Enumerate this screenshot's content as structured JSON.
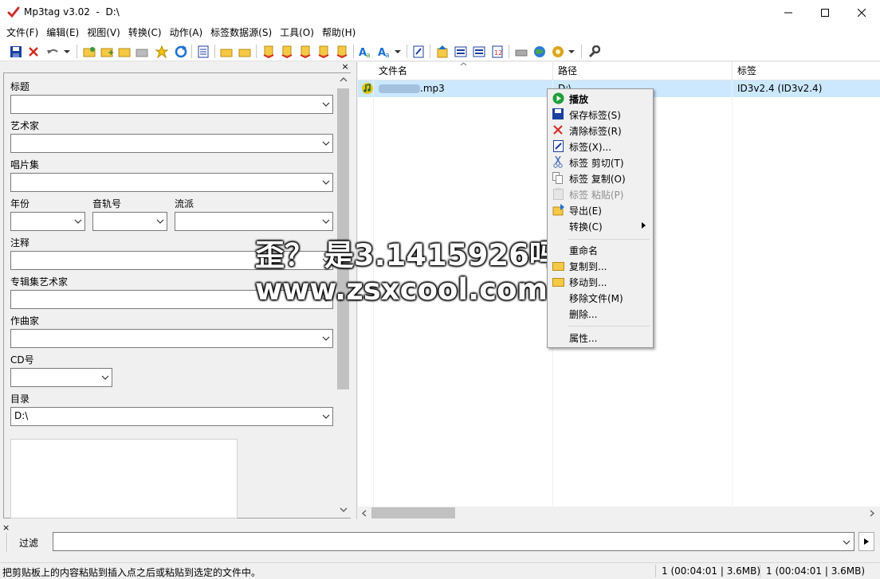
{
  "window": {
    "title": "Mp3tag v3.02  -  D:\\",
    "minimize": "—",
    "maximize": "☐",
    "close": "✕"
  },
  "menu": [
    "文件(F)",
    "编辑(E)",
    "视图(V)",
    "转换(C)",
    "动作(A)",
    "标签数据源(S)",
    "工具(O)",
    "帮助(H)"
  ],
  "tag_panel": {
    "close": "×",
    "fields": {
      "title": {
        "label": "标题",
        "value": ""
      },
      "artist": {
        "label": "艺术家",
        "value": ""
      },
      "album": {
        "label": "唱片集",
        "value": ""
      },
      "year": {
        "label": "年份",
        "value": ""
      },
      "track": {
        "label": "音轨号",
        "value": ""
      },
      "genre": {
        "label": "流派",
        "value": ""
      },
      "comment": {
        "label": "注释",
        "value": ""
      },
      "album_artist": {
        "label": "专辑集艺术家",
        "value": ""
      },
      "composer": {
        "label": "作曲家",
        "value": ""
      },
      "disc": {
        "label": "CD号",
        "value": ""
      },
      "directory": {
        "label": "目录",
        "value": "D:\\"
      }
    }
  },
  "file_list": {
    "columns": [
      "文件名",
      "路径",
      "标签"
    ],
    "rows": [
      {
        "filename": ".mp3",
        "path": "D:\\",
        "tag": "ID3v2.4 (ID3v2.4)"
      }
    ]
  },
  "filter": {
    "label": "过滤",
    "value": "",
    "close": "×"
  },
  "status": {
    "message": "把剪贴板上的内容粘贴到插入点之后或粘贴到选定的文件中。",
    "selected": "1 (00:04:01 | 3.6MB)",
    "total": "1 (00:04:01 | 3.6MB)"
  },
  "context_menu": {
    "play": "播放",
    "save_tag": "保存标签(S)",
    "remove_tag": "清除标签(R)",
    "tag": "标签(X)...",
    "tag_cut": "标签 剪切(T)",
    "tag_copy": "标签 复制(O)",
    "tag_paste": "标签 粘贴(P)",
    "export": "导出(E)",
    "convert": "转换(C)",
    "rename": "重命名",
    "copy_to": "复制到...",
    "move_to": "移动到...",
    "remove_file": "移除文件(M)",
    "delete": "删除...",
    "properties": "属性..."
  },
  "watermark": {
    "line1": "歪？ 是3.1415926吗",
    "line2": "www.zsxcool.com"
  },
  "colors": {
    "selection": "#cce8ff",
    "play_green": "#1e9e3a",
    "save_blue": "#1b3f9e",
    "remove_red": "#d42a1e"
  }
}
